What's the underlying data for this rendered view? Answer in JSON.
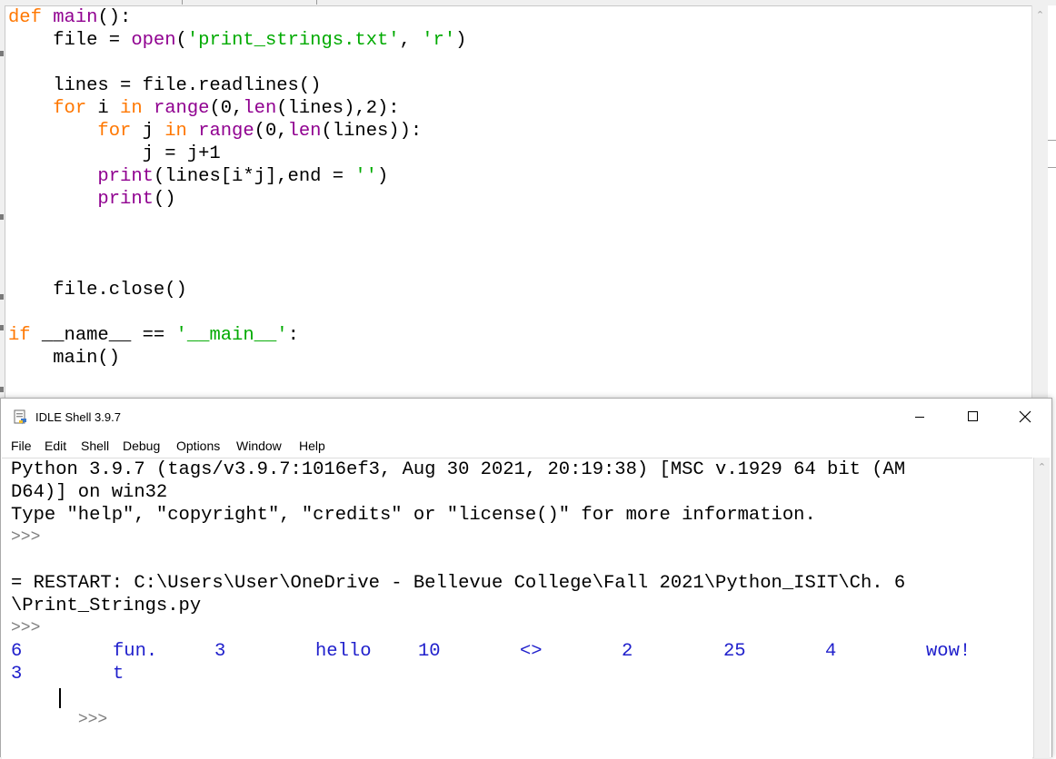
{
  "editor": {
    "lines": [
      [
        {
          "t": "def",
          "c": "kw"
        },
        {
          "t": " "
        },
        {
          "t": "main",
          "c": "bi"
        },
        {
          "t": "():"
        }
      ],
      [
        {
          "t": "    file = "
        },
        {
          "t": "open",
          "c": "bi"
        },
        {
          "t": "("
        },
        {
          "t": "'print_strings.txt'",
          "c": "st"
        },
        {
          "t": ", "
        },
        {
          "t": "'r'",
          "c": "st"
        },
        {
          "t": ")"
        }
      ],
      [],
      [
        {
          "t": "    lines = file.readlines()"
        }
      ],
      [
        {
          "t": "    "
        },
        {
          "t": "for",
          "c": "kw"
        },
        {
          "t": " i "
        },
        {
          "t": "in",
          "c": "kw"
        },
        {
          "t": " "
        },
        {
          "t": "range",
          "c": "bi"
        },
        {
          "t": "(0,"
        },
        {
          "t": "len",
          "c": "bi"
        },
        {
          "t": "(lines),2):"
        }
      ],
      [
        {
          "t": "        "
        },
        {
          "t": "for",
          "c": "kw"
        },
        {
          "t": " j "
        },
        {
          "t": "in",
          "c": "kw"
        },
        {
          "t": " "
        },
        {
          "t": "range",
          "c": "bi"
        },
        {
          "t": "(0,"
        },
        {
          "t": "len",
          "c": "bi"
        },
        {
          "t": "(lines)):"
        }
      ],
      [
        {
          "t": "            j = j+1"
        }
      ],
      [
        {
          "t": "        "
        },
        {
          "t": "print",
          "c": "bi"
        },
        {
          "t": "(lines[i*j],end = "
        },
        {
          "t": "''",
          "c": "st"
        },
        {
          "t": ")"
        }
      ],
      [
        {
          "t": "        "
        },
        {
          "t": "print",
          "c": "bi"
        },
        {
          "t": "()"
        }
      ],
      [],
      [],
      [],
      [
        {
          "t": "    file.close()"
        }
      ],
      [],
      [
        {
          "t": "if",
          "c": "kw"
        },
        {
          "t": " __name__ == "
        },
        {
          "t": "'__main__'",
          "c": "st"
        },
        {
          "t": ":"
        }
      ],
      [
        {
          "t": "    main()"
        }
      ]
    ]
  },
  "shell": {
    "title": "IDLE Shell 3.9.7",
    "menu": [
      "File",
      "Edit",
      "Shell",
      "Debug",
      "Options",
      "Window",
      "Help"
    ],
    "banner_1": "Python 3.9.7 (tags/v3.9.7:1016ef3, Aug 30 2021, 20:19:38) [MSC v.1929 64 bit (AM",
    "banner_2": "D64)] on win32",
    "banner_3": "Type \"help\", \"copyright\", \"credits\" or \"license()\" for more information.",
    "prompt": ">>>",
    "restart_1": "= RESTART: C:\\Users\\User\\OneDrive - Bellevue College\\Fall 2021\\Python_ISIT\\Ch. 6",
    "restart_2": "\\Print_Strings.py",
    "output_row1": [
      "6",
      "fun.",
      "3",
      "hello",
      "10",
      "<>",
      "2",
      "25",
      "4",
      "wow!"
    ],
    "output_row2": [
      "3",
      "t"
    ]
  }
}
